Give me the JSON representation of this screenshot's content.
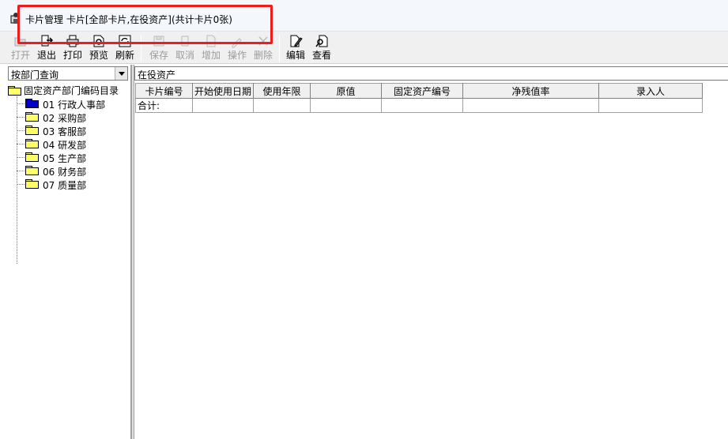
{
  "window": {
    "title": "卡片管理 卡片[全部卡片,在役资产](共计卡片0张)"
  },
  "toolbar": {
    "buttons": [
      {
        "label": "打开",
        "icon": "open-icon",
        "enabled": false
      },
      {
        "label": "退出",
        "icon": "exit-icon",
        "enabled": true
      },
      {
        "label": "打印",
        "icon": "print-icon",
        "enabled": true
      },
      {
        "label": "预览",
        "icon": "preview-icon",
        "enabled": true
      },
      {
        "label": "刷新",
        "icon": "refresh-icon",
        "enabled": true
      },
      {
        "label": "保存",
        "icon": "save-icon",
        "enabled": false
      },
      {
        "label": "取消",
        "icon": "cancel-icon",
        "enabled": false
      },
      {
        "label": "增加",
        "icon": "add-icon",
        "enabled": false
      },
      {
        "label": "操作",
        "icon": "operate-icon",
        "enabled": false
      },
      {
        "label": "删除",
        "icon": "delete-icon",
        "enabled": false
      },
      {
        "label": "编辑",
        "icon": "edit-icon",
        "enabled": true
      },
      {
        "label": "查看",
        "icon": "view-icon",
        "enabled": true
      }
    ]
  },
  "left_panel": {
    "query_mode": "按部门查询",
    "tree": {
      "root": "固定资产部门编码目录",
      "items": [
        {
          "label": "01 行政人事部",
          "selected": true
        },
        {
          "label": "02 采购部",
          "selected": false
        },
        {
          "label": "03 客服部",
          "selected": false
        },
        {
          "label": "04 研发部",
          "selected": false
        },
        {
          "label": "05 生产部",
          "selected": false
        },
        {
          "label": "06 财务部",
          "selected": false
        },
        {
          "label": "07 质量部",
          "selected": false
        }
      ]
    }
  },
  "right_panel": {
    "asset_status": "在役资产",
    "table": {
      "columns": [
        "卡片编号",
        "开始使用日期",
        "使用年限",
        "原值",
        "固定资产编号",
        "净残值率",
        "录入人"
      ],
      "total_label": "合计:"
    }
  },
  "colors": {
    "highlight_border": "#ee1c1c",
    "selected_folder": "#0000cc",
    "folder": "#ffff66"
  }
}
